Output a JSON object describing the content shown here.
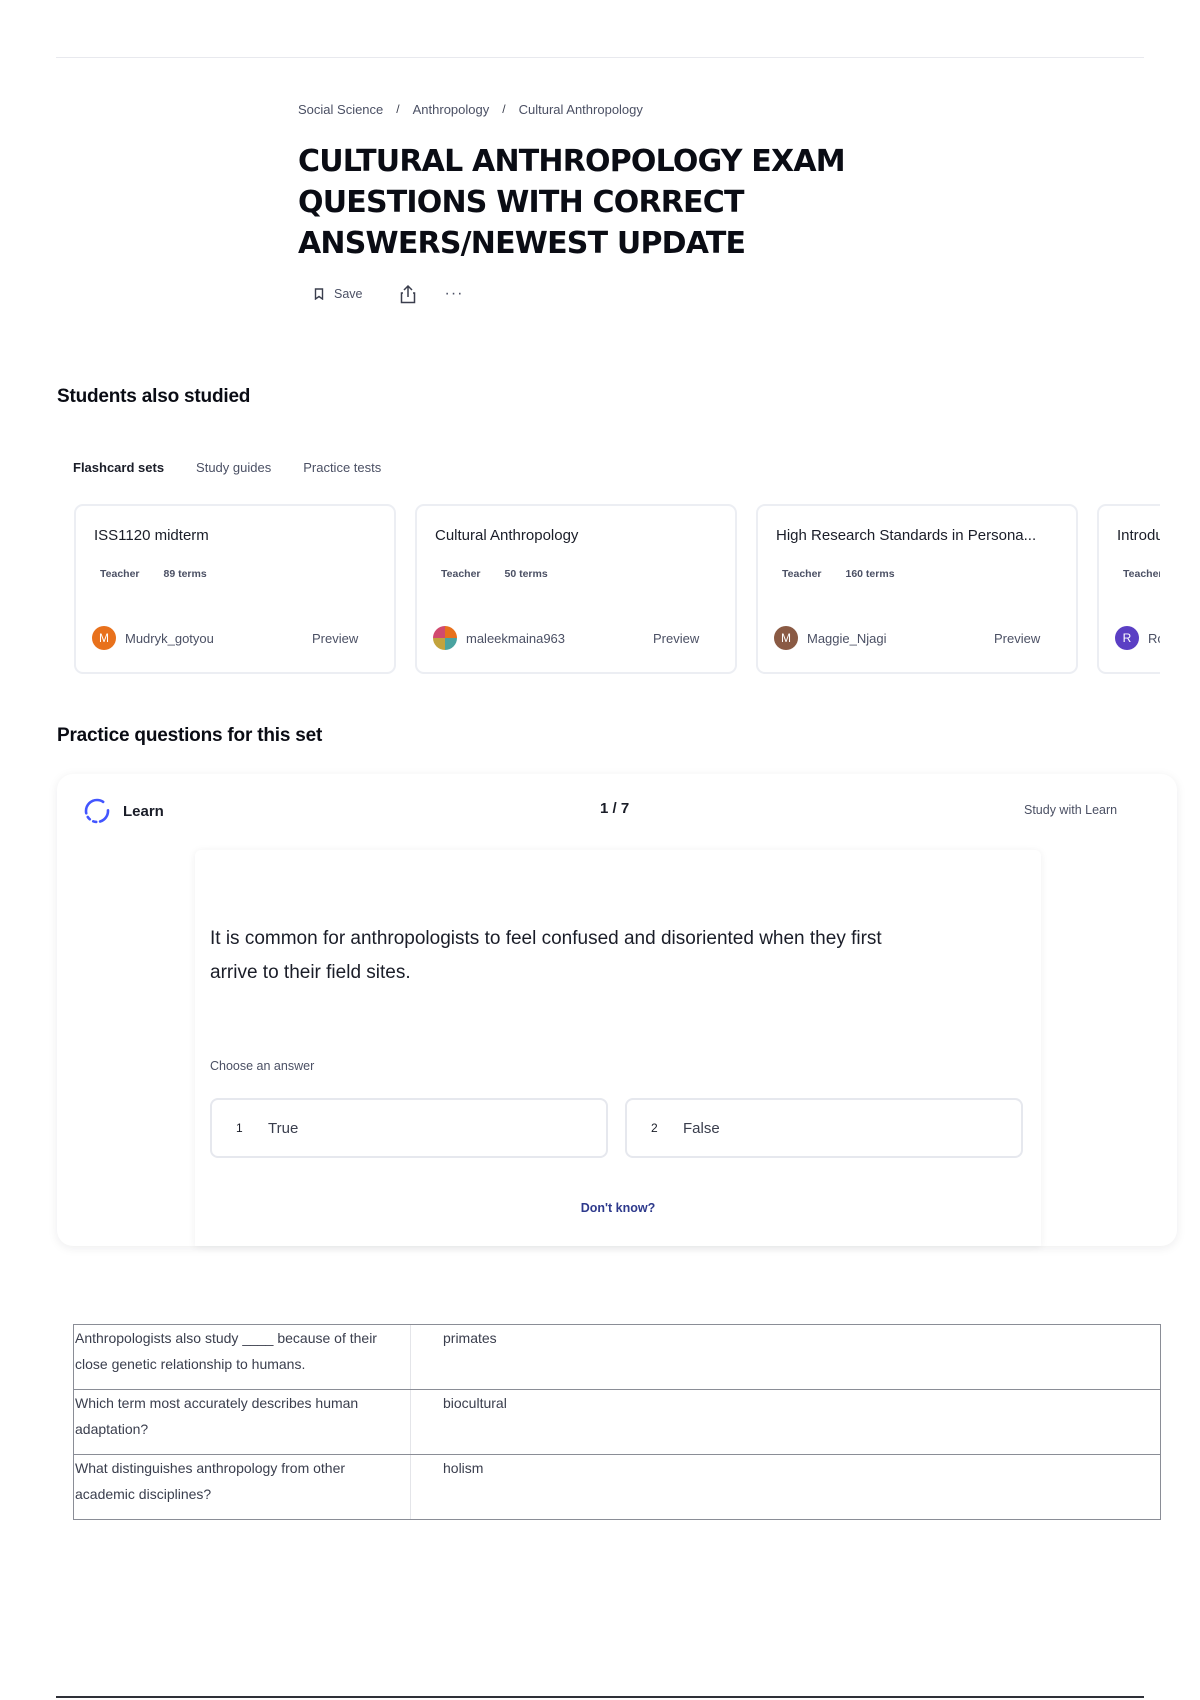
{
  "breadcrumb": [
    "Social Science",
    "Anthropology",
    "Cultural Anthropology"
  ],
  "title": "CULTURAL ANTHROPOLOGY EXAM QUESTIONS WITH CORRECT ANSWERS/NEWEST UPDATE",
  "actions": {
    "save_label": "Save",
    "share_icon": "share-icon",
    "more_label": "···"
  },
  "also_studied": {
    "heading": "Students also studied",
    "tabs": [
      "Flashcard sets",
      "Study guides",
      "Practice tests"
    ],
    "active_tab": "Flashcard sets",
    "cards": [
      {
        "title": "ISS1120 midterm",
        "role": "Teacher",
        "terms": "89 terms",
        "user": "Mudryk_gotyou",
        "avatar_letter": "M",
        "avatar_color": "#e8711c",
        "preview": "Preview"
      },
      {
        "title": "Cultural Anthropology",
        "role": "Teacher",
        "terms": "50 terms",
        "user": "maleekmaina963",
        "avatar_letter": "",
        "avatar_color": "#4aa3a0",
        "preview": "Preview"
      },
      {
        "title": "High Research Standards in Persona...",
        "role": "Teacher",
        "terms": "160 terms",
        "user": "Maggie_Njagi",
        "avatar_letter": "M",
        "avatar_color": "#8a5a44",
        "preview": "Preview"
      },
      {
        "title": "Introdu",
        "role": "Teacher",
        "terms": "",
        "user": "Ro",
        "avatar_letter": "R",
        "avatar_color": "#5b3fc4",
        "preview": ""
      }
    ]
  },
  "practice": {
    "heading": "Practice questions for this set",
    "mode_label": "Learn",
    "counter": "1 / 7",
    "study_link": "Study with Learn",
    "question": "It is common for anthropologists to feel confused and disoriented when they first arrive to their field sites.",
    "choose_label": "Choose an answer",
    "answers": [
      {
        "num": "1",
        "text": "True"
      },
      {
        "num": "2",
        "text": "False"
      }
    ],
    "dont_know": "Don't know?"
  },
  "qa_rows": [
    {
      "q": "Anthropologists also study ____ because of their close genetic relationship to humans.",
      "a": "primates"
    },
    {
      "q": "Which term most accurately describes human adaptation?",
      "a": "biocultural"
    },
    {
      "q": "What distinguishes anthropology from other academic disciplines?",
      "a": "holism"
    }
  ]
}
